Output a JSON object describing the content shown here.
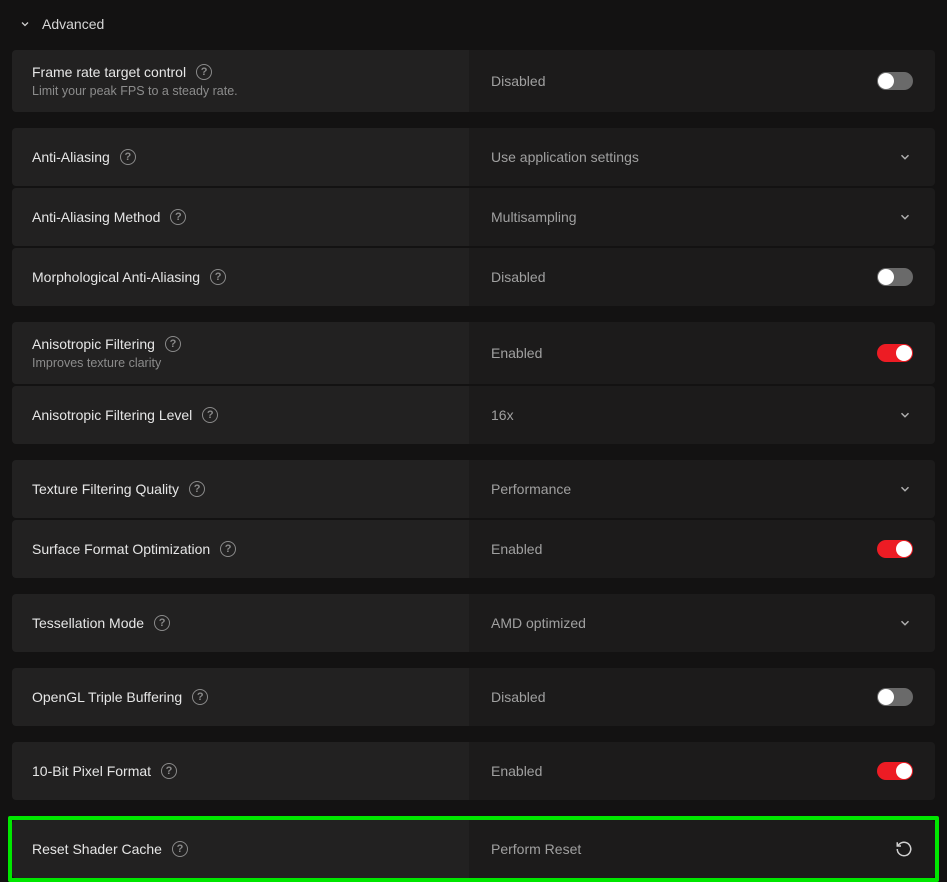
{
  "section": {
    "title": "Advanced"
  },
  "rows": {
    "frtc": {
      "label": "Frame rate target control",
      "sub": "Limit your peak FPS to a steady rate.",
      "value": "Disabled",
      "toggle": "off"
    },
    "aa": {
      "label": "Anti-Aliasing",
      "value": "Use application settings"
    },
    "aam": {
      "label": "Anti-Aliasing Method",
      "value": "Multisampling"
    },
    "maa": {
      "label": "Morphological Anti-Aliasing",
      "value": "Disabled",
      "toggle": "off"
    },
    "af": {
      "label": "Anisotropic Filtering",
      "sub": "Improves texture clarity",
      "value": "Enabled",
      "toggle": "on"
    },
    "afl": {
      "label": "Anisotropic Filtering Level",
      "value": "16x"
    },
    "tfq": {
      "label": "Texture Filtering Quality",
      "value": "Performance"
    },
    "sfo": {
      "label": "Surface Format Optimization",
      "value": "Enabled",
      "toggle": "on"
    },
    "tess": {
      "label": "Tessellation Mode",
      "value": "AMD optimized"
    },
    "otb": {
      "label": "OpenGL Triple Buffering",
      "value": "Disabled",
      "toggle": "off"
    },
    "tbp": {
      "label": "10-Bit Pixel Format",
      "value": "Enabled",
      "toggle": "on"
    },
    "rsc": {
      "label": "Reset Shader Cache",
      "value": "Perform Reset"
    }
  }
}
